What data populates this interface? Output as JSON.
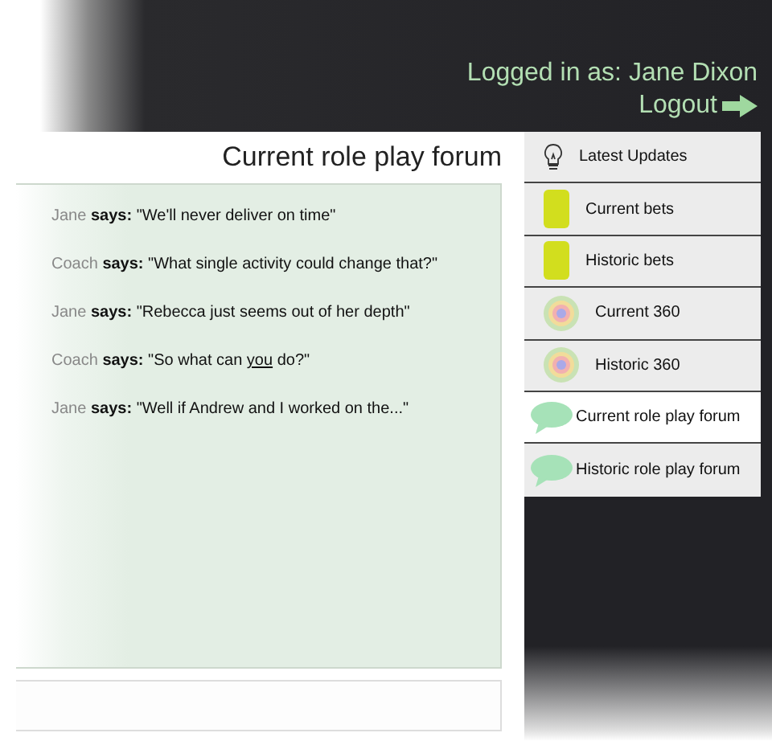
{
  "header": {
    "login_label": "Logged in as:",
    "user_name": "Jane Dixon",
    "logout": "Logout"
  },
  "forum": {
    "title": "Current role play forum",
    "messages": [
      {
        "speaker": "Jane",
        "verb": "says:",
        "quote": [
          {
            "text": "\"We'll never deliver on time\"",
            "underlined": false
          }
        ]
      },
      {
        "speaker": "Coach",
        "verb": "says:",
        "quote": [
          {
            "text": "\"What single activity could change that?\"",
            "underlined": false
          }
        ]
      },
      {
        "speaker": "Jane",
        "verb": "says:",
        "quote": [
          {
            "text": "\"Rebecca just seems out of her depth\"",
            "underlined": false
          }
        ]
      },
      {
        "speaker": "Coach",
        "verb": "says:",
        "quote": [
          {
            "text": "\"So what can ",
            "underlined": false
          },
          {
            "text": "you",
            "underlined": true
          },
          {
            "text": " do?\"",
            "underlined": false
          }
        ]
      },
      {
        "speaker": "Jane",
        "verb": "says:",
        "quote": [
          {
            "text": "\"Well if Andrew and I worked on the...\"",
            "underlined": false
          }
        ]
      }
    ]
  },
  "sidebar": {
    "items": [
      {
        "label": "Latest Updates",
        "kind": "bulb",
        "selected": false
      },
      {
        "label": "Current bets",
        "kind": "barrel",
        "selected": false
      },
      {
        "label": "Historic bets",
        "kind": "barrel",
        "selected": false
      },
      {
        "label": "Current 360",
        "kind": "target",
        "selected": false
      },
      {
        "label": "Historic 360",
        "kind": "target",
        "selected": false
      },
      {
        "label": "Current role play forum",
        "kind": "bubble",
        "selected": true
      },
      {
        "label": "Historic role play forum",
        "kind": "bubble",
        "selected": false
      }
    ]
  }
}
